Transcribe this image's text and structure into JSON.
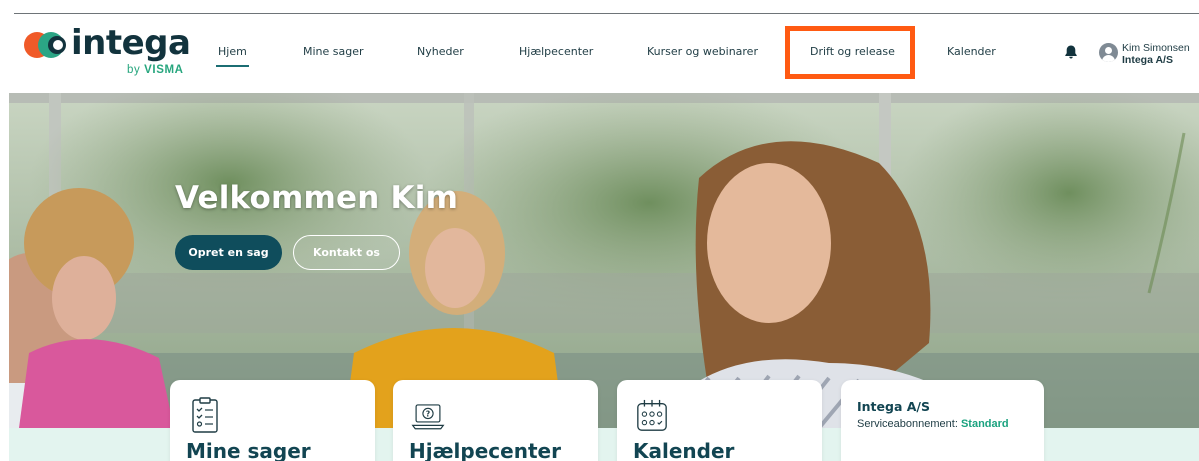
{
  "brand": {
    "name": "intega",
    "by": "by",
    "parent": "VISMA",
    "colors": {
      "orange": "#f05a28",
      "green": "#2ba585",
      "navy": "#12333d"
    }
  },
  "nav": {
    "items": [
      {
        "label": "Hjem",
        "active": true
      },
      {
        "label": "Mine sager"
      },
      {
        "label": "Nyheder"
      },
      {
        "label": "Hjælpecenter"
      },
      {
        "label": "Kurser og webinarer"
      },
      {
        "label": "Drift og release",
        "highlighted": true
      },
      {
        "label": "Kalender"
      }
    ],
    "highlight_color": "#ff5a12"
  },
  "user": {
    "name": "Kim Simonsen",
    "company": "Intega A/S",
    "icons": [
      "bell-icon",
      "user-avatar-icon"
    ]
  },
  "hero": {
    "title": "Velkommen Kim",
    "primary_button": "Opret en sag",
    "secondary_button": "Kontakt os"
  },
  "cards": [
    {
      "title": "Mine sager",
      "icon": "checklist-icon"
    },
    {
      "title": "Hjælpecenter",
      "icon": "laptop-question-icon"
    },
    {
      "title": "Kalender",
      "icon": "calendar-icon"
    }
  ],
  "info_card": {
    "company": "Intega A/S",
    "service_label": "Serviceabonnement:",
    "plan": "Standard"
  }
}
